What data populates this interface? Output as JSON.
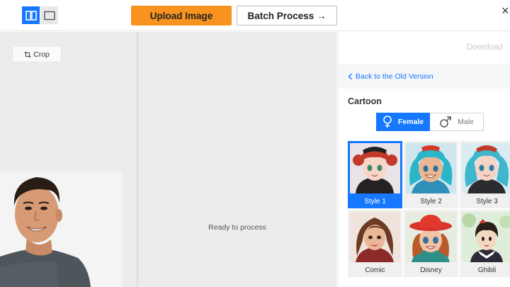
{
  "toolbar": {
    "upload_label": "Upload Image",
    "batch_label": "Batch Process →",
    "close_glyph": "×"
  },
  "left_pane": {
    "crop_label": "Crop"
  },
  "middle_pane": {
    "status_text": "Ready to process"
  },
  "right_pane": {
    "download_label": "Download",
    "back_label": "Back to the Old Version",
    "section_title": "Cartoon",
    "gender": {
      "female_label": "Female",
      "male_label": "Male",
      "selected": "female"
    },
    "styles": [
      {
        "label": "Style 1",
        "selected": true
      },
      {
        "label": "Style 2",
        "selected": false
      },
      {
        "label": "Style 3",
        "selected": false
      },
      {
        "label": "Comic",
        "selected": false
      },
      {
        "label": "Disney",
        "selected": false
      },
      {
        "label": "Ghibli",
        "selected": false
      }
    ]
  },
  "colors": {
    "accent": "#1677ff",
    "upload": "#f7931e"
  }
}
